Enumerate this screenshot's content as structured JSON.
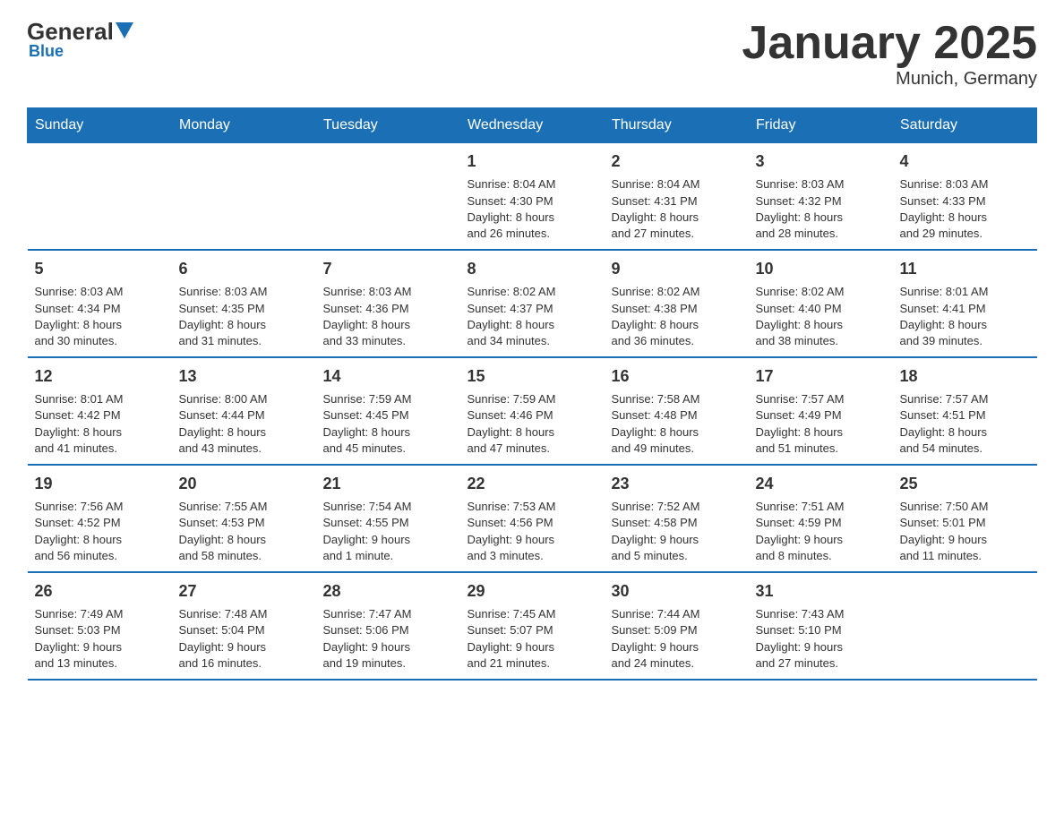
{
  "header": {
    "title": "January 2025",
    "subtitle": "Munich, Germany",
    "logo_general": "General",
    "logo_blue": "Blue"
  },
  "days_of_week": [
    "Sunday",
    "Monday",
    "Tuesday",
    "Wednesday",
    "Thursday",
    "Friday",
    "Saturday"
  ],
  "weeks": [
    [
      {
        "day": "",
        "info": ""
      },
      {
        "day": "",
        "info": ""
      },
      {
        "day": "",
        "info": ""
      },
      {
        "day": "1",
        "info": "Sunrise: 8:04 AM\nSunset: 4:30 PM\nDaylight: 8 hours\nand 26 minutes."
      },
      {
        "day": "2",
        "info": "Sunrise: 8:04 AM\nSunset: 4:31 PM\nDaylight: 8 hours\nand 27 minutes."
      },
      {
        "day": "3",
        "info": "Sunrise: 8:03 AM\nSunset: 4:32 PM\nDaylight: 8 hours\nand 28 minutes."
      },
      {
        "day": "4",
        "info": "Sunrise: 8:03 AM\nSunset: 4:33 PM\nDaylight: 8 hours\nand 29 minutes."
      }
    ],
    [
      {
        "day": "5",
        "info": "Sunrise: 8:03 AM\nSunset: 4:34 PM\nDaylight: 8 hours\nand 30 minutes."
      },
      {
        "day": "6",
        "info": "Sunrise: 8:03 AM\nSunset: 4:35 PM\nDaylight: 8 hours\nand 31 minutes."
      },
      {
        "day": "7",
        "info": "Sunrise: 8:03 AM\nSunset: 4:36 PM\nDaylight: 8 hours\nand 33 minutes."
      },
      {
        "day": "8",
        "info": "Sunrise: 8:02 AM\nSunset: 4:37 PM\nDaylight: 8 hours\nand 34 minutes."
      },
      {
        "day": "9",
        "info": "Sunrise: 8:02 AM\nSunset: 4:38 PM\nDaylight: 8 hours\nand 36 minutes."
      },
      {
        "day": "10",
        "info": "Sunrise: 8:02 AM\nSunset: 4:40 PM\nDaylight: 8 hours\nand 38 minutes."
      },
      {
        "day": "11",
        "info": "Sunrise: 8:01 AM\nSunset: 4:41 PM\nDaylight: 8 hours\nand 39 minutes."
      }
    ],
    [
      {
        "day": "12",
        "info": "Sunrise: 8:01 AM\nSunset: 4:42 PM\nDaylight: 8 hours\nand 41 minutes."
      },
      {
        "day": "13",
        "info": "Sunrise: 8:00 AM\nSunset: 4:44 PM\nDaylight: 8 hours\nand 43 minutes."
      },
      {
        "day": "14",
        "info": "Sunrise: 7:59 AM\nSunset: 4:45 PM\nDaylight: 8 hours\nand 45 minutes."
      },
      {
        "day": "15",
        "info": "Sunrise: 7:59 AM\nSunset: 4:46 PM\nDaylight: 8 hours\nand 47 minutes."
      },
      {
        "day": "16",
        "info": "Sunrise: 7:58 AM\nSunset: 4:48 PM\nDaylight: 8 hours\nand 49 minutes."
      },
      {
        "day": "17",
        "info": "Sunrise: 7:57 AM\nSunset: 4:49 PM\nDaylight: 8 hours\nand 51 minutes."
      },
      {
        "day": "18",
        "info": "Sunrise: 7:57 AM\nSunset: 4:51 PM\nDaylight: 8 hours\nand 54 minutes."
      }
    ],
    [
      {
        "day": "19",
        "info": "Sunrise: 7:56 AM\nSunset: 4:52 PM\nDaylight: 8 hours\nand 56 minutes."
      },
      {
        "day": "20",
        "info": "Sunrise: 7:55 AM\nSunset: 4:53 PM\nDaylight: 8 hours\nand 58 minutes."
      },
      {
        "day": "21",
        "info": "Sunrise: 7:54 AM\nSunset: 4:55 PM\nDaylight: 9 hours\nand 1 minute."
      },
      {
        "day": "22",
        "info": "Sunrise: 7:53 AM\nSunset: 4:56 PM\nDaylight: 9 hours\nand 3 minutes."
      },
      {
        "day": "23",
        "info": "Sunrise: 7:52 AM\nSunset: 4:58 PM\nDaylight: 9 hours\nand 5 minutes."
      },
      {
        "day": "24",
        "info": "Sunrise: 7:51 AM\nSunset: 4:59 PM\nDaylight: 9 hours\nand 8 minutes."
      },
      {
        "day": "25",
        "info": "Sunrise: 7:50 AM\nSunset: 5:01 PM\nDaylight: 9 hours\nand 11 minutes."
      }
    ],
    [
      {
        "day": "26",
        "info": "Sunrise: 7:49 AM\nSunset: 5:03 PM\nDaylight: 9 hours\nand 13 minutes."
      },
      {
        "day": "27",
        "info": "Sunrise: 7:48 AM\nSunset: 5:04 PM\nDaylight: 9 hours\nand 16 minutes."
      },
      {
        "day": "28",
        "info": "Sunrise: 7:47 AM\nSunset: 5:06 PM\nDaylight: 9 hours\nand 19 minutes."
      },
      {
        "day": "29",
        "info": "Sunrise: 7:45 AM\nSunset: 5:07 PM\nDaylight: 9 hours\nand 21 minutes."
      },
      {
        "day": "30",
        "info": "Sunrise: 7:44 AM\nSunset: 5:09 PM\nDaylight: 9 hours\nand 24 minutes."
      },
      {
        "day": "31",
        "info": "Sunrise: 7:43 AM\nSunset: 5:10 PM\nDaylight: 9 hours\nand 27 minutes."
      },
      {
        "day": "",
        "info": ""
      }
    ]
  ]
}
